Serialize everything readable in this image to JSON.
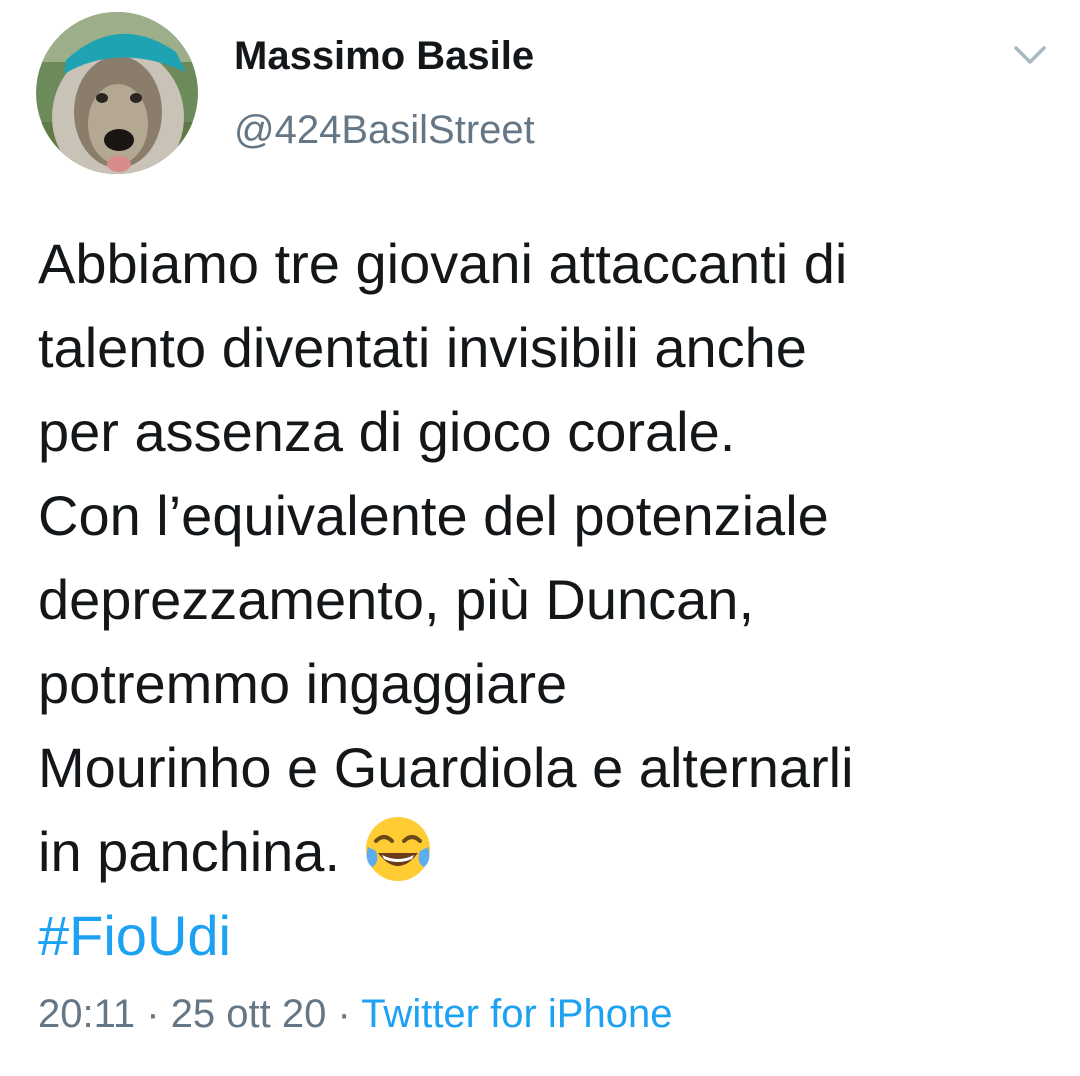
{
  "author": {
    "name": "Massimo Basile",
    "handle": "@424BasilStreet",
    "avatar_icon": "dog-avatar-icon"
  },
  "tweet": {
    "lines": [
      "Abbiamo tre giovani attaccanti di",
      "talento diventati invisibili anche",
      "per assenza di gioco corale.",
      "Con l’equivalente del potenziale",
      "deprezzamento, più Duncan,",
      "potremmo ingaggiare",
      "Mourinho e Guardiola e alternarli",
      "in panchina."
    ],
    "emoji": "face-with-tears-of-joy-icon",
    "hashtag": "#FioUdi"
  },
  "meta": {
    "time": "20:11",
    "separator1": " · ",
    "date": "25 ott 20",
    "separator2": " · ",
    "source": "Twitter for iPhone"
  },
  "colors": {
    "text": "#14171a",
    "secondary": "#657786",
    "link": "#1da1f2"
  }
}
